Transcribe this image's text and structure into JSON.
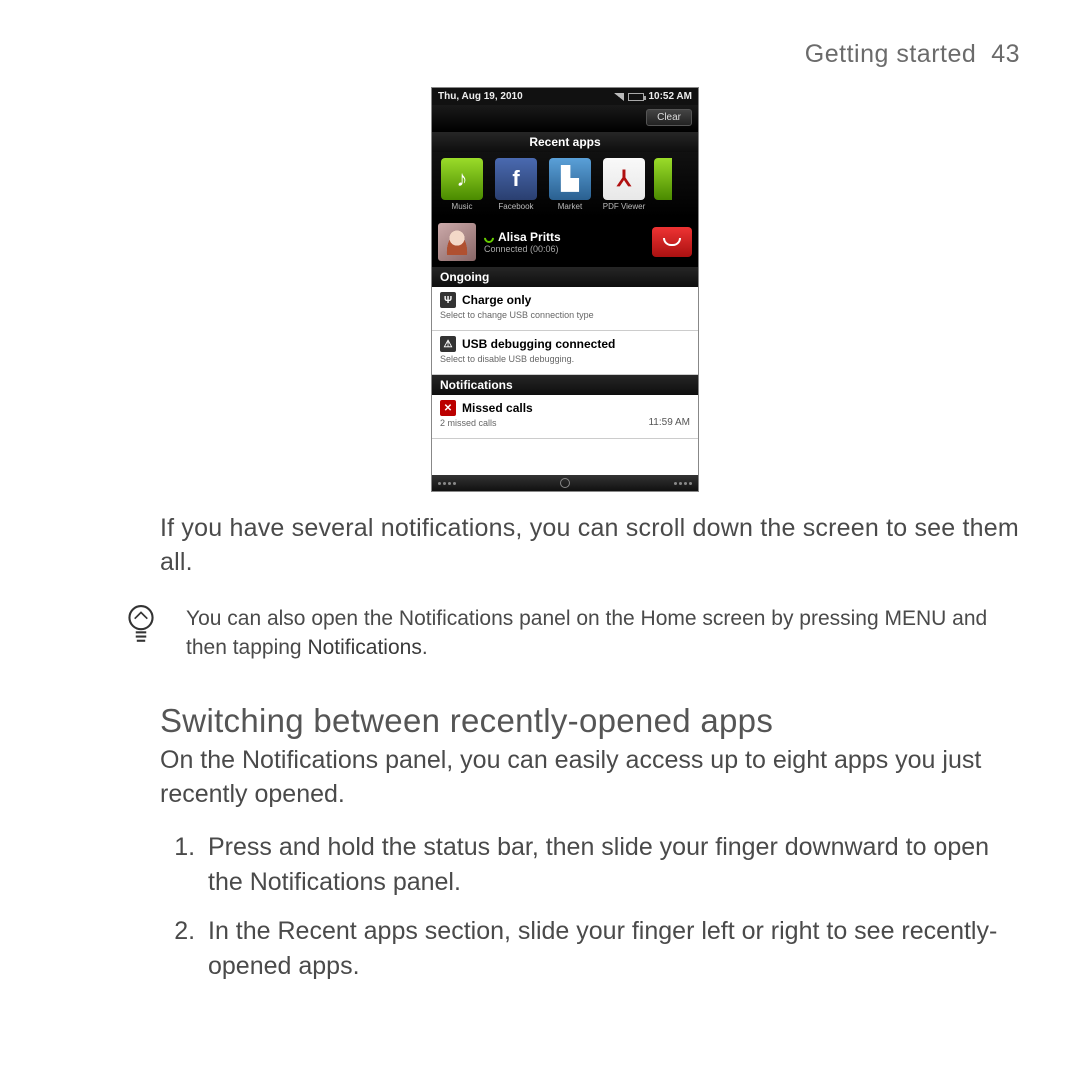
{
  "header": {
    "chapter": "Getting started",
    "page": "43"
  },
  "phone": {
    "statusbar": {
      "date": "Thu, Aug 19, 2010",
      "time": "10:52 AM"
    },
    "clear_label": "Clear",
    "recent_title": "Recent apps",
    "apps": [
      {
        "label": "Music"
      },
      {
        "label": "Facebook"
      },
      {
        "label": "Market"
      },
      {
        "label": "PDF Viewer"
      }
    ],
    "call": {
      "name": "Alisa Pritts",
      "status": "Connected (00:06)"
    },
    "ongoing_title": "Ongoing",
    "ongoing": [
      {
        "title": "Charge only",
        "sub": "Select to change USB connection type"
      },
      {
        "title": "USB debugging connected",
        "sub": "Select to disable USB debugging."
      }
    ],
    "notifications_title": "Notifications",
    "notifications": [
      {
        "title": "Missed calls",
        "sub": "2 missed calls",
        "time": "11:59 AM"
      }
    ]
  },
  "body": {
    "para1": "If you have several notifications, you can scroll down the screen to see them all.",
    "tip_a": "You can also open the Notifications panel on the Home screen by pressing MENU and then tapping ",
    "tip_b": "Notifications",
    "tip_c": ".",
    "h2": "Switching between recently-opened apps",
    "h2_sub": "On the Notifications panel, you can easily access up to eight apps you just recently opened.",
    "steps": [
      "Press and hold the status bar, then slide your finger downward to open the Notifications panel.",
      "In the Recent apps section, slide your finger left or right to see recently-opened apps."
    ]
  }
}
